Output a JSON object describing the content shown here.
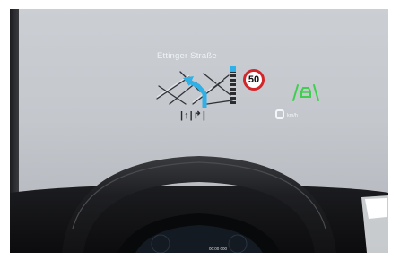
{
  "hud": {
    "street_name": "Ettinger Straße",
    "speed_limit": "50",
    "lane_indicator": "|↑|↱|",
    "current_speed": "",
    "speed_unit": "km/h"
  },
  "cluster": {
    "readout": "00:00 000"
  },
  "icons": {
    "map": "navigation-map-icon",
    "car": "lane-assist-car-icon",
    "sign": "speed-limit-sign-icon"
  },
  "colors": {
    "route": "#2fb0e6",
    "assist": "#3fcf4e",
    "limit_ring": "#d3262b",
    "hud_text": "#eef3f7"
  }
}
